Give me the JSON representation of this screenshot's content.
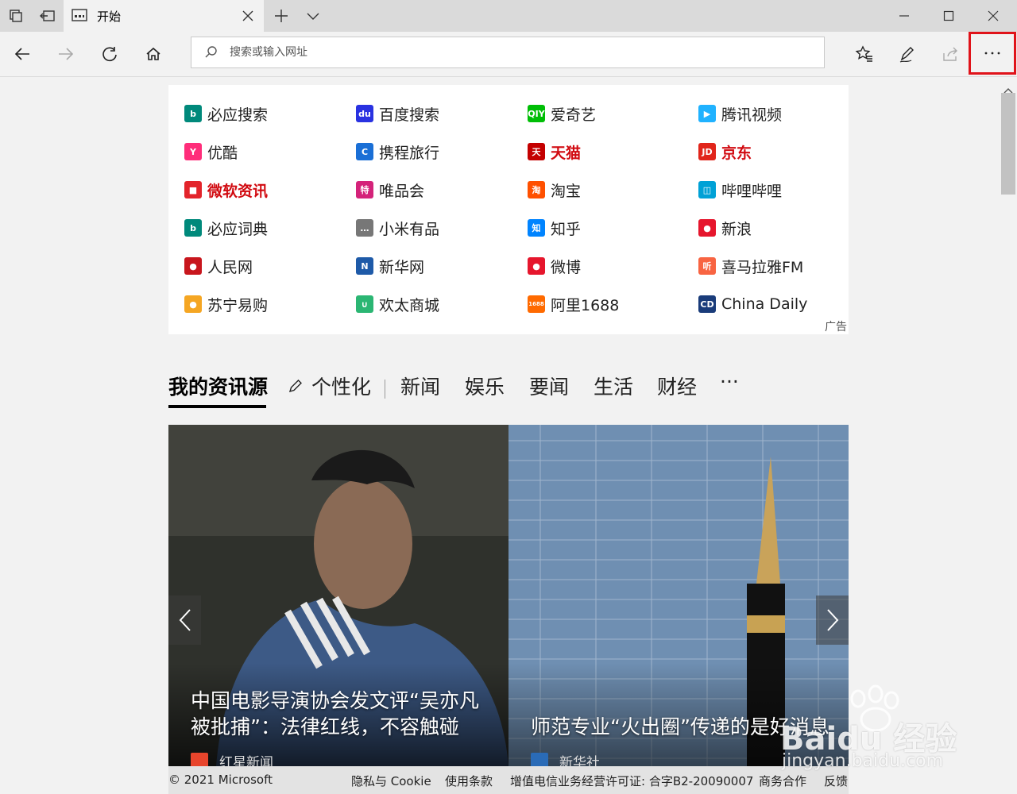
{
  "tab": {
    "title": "开始"
  },
  "address_bar": {
    "placeholder": "搜索或输入网址"
  },
  "top_sites": {
    "items": [
      {
        "label": "必应搜索",
        "icon": "bing-icon",
        "color": "#00897b",
        "style": ""
      },
      {
        "label": "百度搜索",
        "icon": "baidu-paw-icon",
        "color": "#2932e1",
        "style": ""
      },
      {
        "label": "爱奇艺",
        "icon": "iqiyi-icon",
        "color": "#00be06",
        "style": ""
      },
      {
        "label": "腾讯视频",
        "icon": "tencent-video-icon",
        "color": "#20b2ff",
        "style": ""
      },
      {
        "label": "优酷",
        "icon": "youku-icon",
        "color": "#ff2d7a",
        "style": ""
      },
      {
        "label": "携程旅行",
        "icon": "ctrip-icon",
        "color": "#1a6fd6",
        "style": ""
      },
      {
        "label": "天猫",
        "icon": "tmall-icon",
        "color": "#c40000",
        "style": "red"
      },
      {
        "label": "京东",
        "icon": "jd-icon",
        "color": "#e1251b",
        "style": "red"
      },
      {
        "label": "微软资讯",
        "icon": "msn-news-icon",
        "color": "#e3242b",
        "style": "red"
      },
      {
        "label": "唯品会",
        "icon": "vip-icon",
        "color": "#d4237a",
        "style": ""
      },
      {
        "label": "淘宝",
        "icon": "taobao-icon",
        "color": "#ff5000",
        "style": ""
      },
      {
        "label": "哔哩哔哩",
        "icon": "bilibili-icon",
        "color": "#00a1d6",
        "style": ""
      },
      {
        "label": "必应词典",
        "icon": "bing-dict-icon",
        "color": "#00897b",
        "style": ""
      },
      {
        "label": "小米有品",
        "icon": "xiaomi-youpin-icon",
        "color": "#777777",
        "style": ""
      },
      {
        "label": "知乎",
        "icon": "zhihu-icon",
        "color": "#0084ff",
        "style": ""
      },
      {
        "label": "新浪",
        "icon": "sina-icon",
        "color": "#e6162d",
        "style": ""
      },
      {
        "label": "人民网",
        "icon": "people-icon",
        "color": "#c8161d",
        "style": ""
      },
      {
        "label": "新华网",
        "icon": "xinhua-icon",
        "color": "#1e5aa8",
        "style": ""
      },
      {
        "label": "微博",
        "icon": "weibo-icon",
        "color": "#e6162d",
        "style": ""
      },
      {
        "label": "喜马拉雅FM",
        "icon": "ximalaya-icon",
        "color": "#f86442",
        "style": ""
      },
      {
        "label": "苏宁易购",
        "icon": "suning-icon",
        "color": "#f5a623",
        "style": ""
      },
      {
        "label": "欢太商城",
        "icon": "heytap-icon",
        "color": "#2bb673",
        "style": ""
      },
      {
        "label": "阿里1688",
        "icon": "ali1688-icon",
        "color": "#ff6a00",
        "style": ""
      },
      {
        "label": "China Daily",
        "icon": "chinadaily-icon",
        "color": "#1a3c7a",
        "style": ""
      }
    ],
    "icon_text": [
      "b",
      "du",
      "QIY",
      "▶",
      "Y",
      "C",
      "天",
      "JD",
      "■",
      "特",
      "淘",
      "◫",
      "b",
      "…",
      "知",
      "●",
      "●",
      "N",
      "●",
      "听",
      "●",
      "∪",
      "1688",
      "CD"
    ],
    "ad_label": "广告"
  },
  "feed_tabs": {
    "items": [
      "我的资讯源",
      "个性化",
      "新闻",
      "娱乐",
      "要闻",
      "生活",
      "财经",
      "···"
    ]
  },
  "carousel": {
    "cards": [
      {
        "title_line1": "中国电影导演协会发文评“吴亦凡",
        "title_line2": "被批捕”：法律红线，不容触碰",
        "source": "红星新闻"
      },
      {
        "title_line1": "",
        "title_line2": "师范专业“火出圈”传递的是好消息",
        "source": "新华社"
      }
    ]
  },
  "footer": {
    "copyright": "© 2021 Microsoft",
    "privacy": "隐私与 Cookie",
    "terms": "使用条款",
    "license": "增值电信业务经营许可证: 合字B2-20090007",
    "business": "商务合作",
    "feedback": "反馈"
  },
  "watermark": {
    "brand": "Baidu 经验",
    "domain": "jingyan.baidu.com"
  }
}
